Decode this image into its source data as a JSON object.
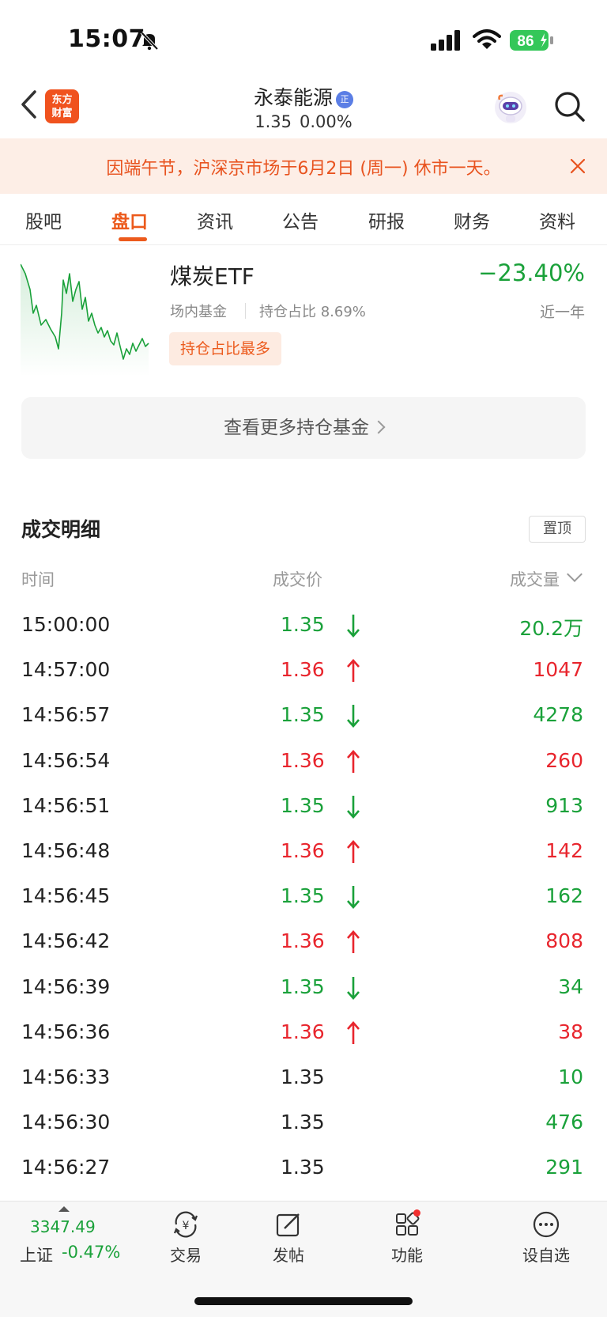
{
  "status_bar": {
    "time": "15:07",
    "battery": "86"
  },
  "header": {
    "title": "永泰能源",
    "title_badge": "正",
    "price": "1.35",
    "change_pct": "0.00%",
    "logo_text_1": "东方",
    "logo_text_2": "财富"
  },
  "notice": {
    "text": "因端午节，沪深京市场于6月2日 (周一) 休市一天。"
  },
  "tabs": [
    {
      "label": "股吧"
    },
    {
      "label": "盘口"
    },
    {
      "label": "资讯"
    },
    {
      "label": "公告"
    },
    {
      "label": "研报"
    },
    {
      "label": "财务"
    },
    {
      "label": "资料"
    }
  ],
  "active_tab": "盘口",
  "fund": {
    "name": "煤炭ETF",
    "change": "−23.40%",
    "period": "近一年",
    "type": "场内基金",
    "holding": "持仓占比 8.69%",
    "tag": "持仓占比最多"
  },
  "more_funds_label": "查看更多持仓基金",
  "trade_detail": {
    "title": "成交明细",
    "pin_label": "置顶",
    "columns": {
      "time": "时间",
      "price": "成交价",
      "volume": "成交量"
    },
    "rows": [
      {
        "time": "15:00:00",
        "price": "1.35",
        "dir": "down",
        "volume": "20.2万"
      },
      {
        "time": "14:57:00",
        "price": "1.36",
        "dir": "up",
        "volume": "1047"
      },
      {
        "time": "14:56:57",
        "price": "1.35",
        "dir": "down",
        "volume": "4278"
      },
      {
        "time": "14:56:54",
        "price": "1.36",
        "dir": "up",
        "volume": "260"
      },
      {
        "time": "14:56:51",
        "price": "1.35",
        "dir": "down",
        "volume": "913"
      },
      {
        "time": "14:56:48",
        "price": "1.36",
        "dir": "up",
        "volume": "142"
      },
      {
        "time": "14:56:45",
        "price": "1.35",
        "dir": "down",
        "volume": "162"
      },
      {
        "time": "14:56:42",
        "price": "1.36",
        "dir": "up",
        "volume": "808"
      },
      {
        "time": "14:56:39",
        "price": "1.35",
        "dir": "down",
        "volume": "34"
      },
      {
        "time": "14:56:36",
        "price": "1.36",
        "dir": "up",
        "volume": "38"
      },
      {
        "time": "14:56:33",
        "price": "1.35",
        "dir": "none",
        "volume": "10"
      },
      {
        "time": "14:56:30",
        "price": "1.35",
        "dir": "none",
        "volume": "476"
      },
      {
        "time": "14:56:27",
        "price": "1.35",
        "dir": "none",
        "volume": "291"
      }
    ]
  },
  "bottom_bar": {
    "index_value": "3347.49",
    "index_name": "上证",
    "index_pct": "-0.47%",
    "items": [
      {
        "label": "交易",
        "icon": "trade-icon"
      },
      {
        "label": "发帖",
        "icon": "post-icon"
      },
      {
        "label": "功能",
        "icon": "grid-icon"
      },
      {
        "label": "设自选",
        "icon": "more-icon"
      }
    ]
  },
  "colors": {
    "up": "#e8252d",
    "down": "#1aa13a",
    "accent": "#ec5a1c"
  }
}
